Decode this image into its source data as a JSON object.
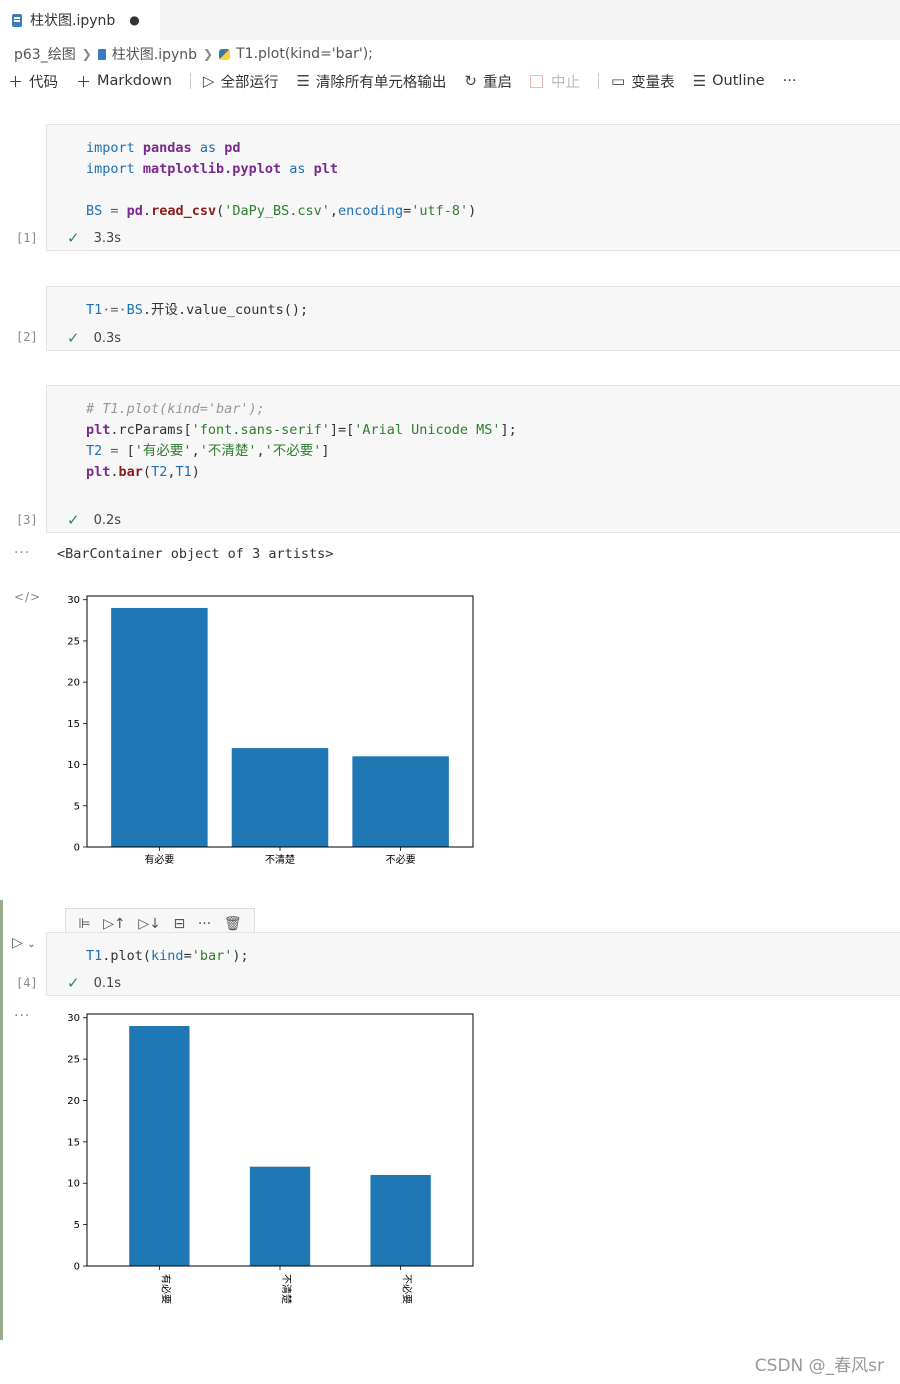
{
  "tab": {
    "title": "柱状图.ipynb",
    "modified": "●"
  },
  "breadcrumb": {
    "folder": "p63_绘图",
    "file": "柱状图.ipynb",
    "symbol": "T1.plot(kind='bar');"
  },
  "toolbar": {
    "code": "代码",
    "markdown": "Markdown",
    "run_all": "全部运行",
    "clear": "清除所有单元格输出",
    "restart": "重启",
    "interrupt": "中止",
    "variables": "变量表",
    "outline": "Outline",
    "more": "···"
  },
  "cells": [
    {
      "exec": "[1]",
      "time": "3.3s",
      "lines": [
        [
          [
            "kw",
            "import "
          ],
          [
            "bold",
            "pandas"
          ],
          [
            "kw",
            " as "
          ],
          [
            "bold",
            "pd"
          ]
        ],
        [
          [
            "kw",
            "import "
          ],
          [
            "bold",
            "matplotlib.pyplot"
          ],
          [
            "kw",
            " as "
          ],
          [
            "bold",
            "plt"
          ]
        ],
        [],
        [
          [
            "var",
            "BS"
          ],
          [
            "gray",
            " = "
          ],
          [
            "bold",
            "pd"
          ],
          [
            "",
            "."
          ],
          [
            "fn",
            "read_csv"
          ],
          [
            "",
            "("
          ],
          [
            "str",
            "'DaPy_BS.csv'"
          ],
          [
            "",
            ","
          ],
          [
            "kw",
            "encoding"
          ],
          [
            "",
            "="
          ],
          [
            "str",
            "'utf-8'"
          ],
          [
            "",
            ")"
          ]
        ]
      ]
    },
    {
      "exec": "[2]",
      "time": "0.3s",
      "lines": [
        [
          [
            "var",
            "T1"
          ],
          [
            "gray",
            "·=·"
          ],
          [
            "var",
            "BS"
          ],
          [
            "",
            ".开设.value_counts"
          ],
          [
            "",
            "();"
          ]
        ]
      ]
    },
    {
      "exec": "[3]",
      "time": "0.2s",
      "lines": [
        [
          [
            "cmt",
            "# T1.plot(kind='bar');"
          ]
        ],
        [
          [
            "bold",
            "plt"
          ],
          [
            "",
            ".rcParams["
          ],
          [
            "str",
            "'font.sans-serif'"
          ],
          [
            "",
            "]=["
          ],
          [
            "str",
            "'Arial Unicode MS'"
          ],
          [
            "",
            "];"
          ]
        ],
        [
          [
            "var",
            "T2"
          ],
          [
            "gray",
            " = "
          ],
          [
            "",
            "["
          ],
          [
            "str",
            "'有必要'"
          ],
          [
            "",
            ","
          ],
          [
            "str",
            "'不清楚'"
          ],
          [
            "",
            ","
          ],
          [
            "str",
            "'不必要'"
          ],
          [
            "",
            "]"
          ]
        ],
        [
          [
            "bold",
            "plt"
          ],
          [
            "",
            "."
          ],
          [
            "fn",
            "bar"
          ],
          [
            "",
            "("
          ],
          [
            "var",
            "T2"
          ],
          [
            "",
            ","
          ],
          [
            "var",
            "T1"
          ],
          [
            "",
            ")"
          ]
        ]
      ]
    },
    {
      "exec": "[4]",
      "time": "0.1s",
      "lines": [
        [
          [
            "var",
            "T1"
          ],
          [
            "",
            ".plot("
          ],
          [
            "kw",
            "kind"
          ],
          [
            "",
            "="
          ],
          [
            "str",
            "'bar'"
          ],
          [
            "",
            ");"
          ]
        ]
      ]
    }
  ],
  "output3_text": "<BarContainer object of 3 artists>",
  "more_dots": "···",
  "code_icon": "</>",
  "cell_tools": [
    "⊫",
    "▷↑",
    "▷↓",
    "⊟",
    "···",
    "🗑"
  ],
  "watermark": "CSDN @_春风sr",
  "chart_data": [
    {
      "type": "bar",
      "categories": [
        "有必要",
        "不清楚",
        "不必要"
      ],
      "values": [
        29,
        12,
        11
      ],
      "yticks": [
        0,
        5,
        10,
        15,
        20,
        25,
        30
      ],
      "ylim": [
        0,
        30.45
      ],
      "color": "#1f77b4",
      "xlabel_rotation": 0
    },
    {
      "type": "bar",
      "categories": [
        "有必要",
        "不清楚",
        "不必要"
      ],
      "values": [
        29,
        12,
        11
      ],
      "yticks": [
        0,
        5,
        10,
        15,
        20,
        25,
        30
      ],
      "ylim": [
        0,
        30.45
      ],
      "color": "#1f77b4",
      "xlabel_rotation": 90
    }
  ]
}
